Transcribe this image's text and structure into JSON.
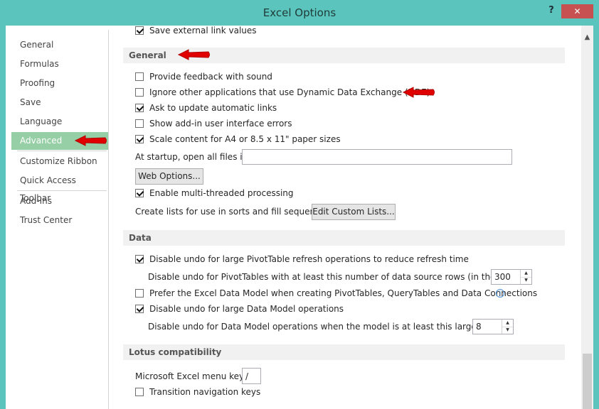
{
  "window": {
    "title": "Excel Options",
    "help_label": "?",
    "close_label": "✕"
  },
  "nav": {
    "items": [
      {
        "label": "General"
      },
      {
        "label": "Formulas"
      },
      {
        "label": "Proofing"
      },
      {
        "label": "Save"
      },
      {
        "label": "Language"
      },
      {
        "label": "Advanced",
        "active": true
      },
      {
        "label": "Customize Ribbon"
      },
      {
        "label": "Quick Access Toolbar"
      },
      {
        "label": "Add-Ins"
      },
      {
        "label": "Trust Center"
      }
    ]
  },
  "content": {
    "partial_top": {
      "label": "Save external link values",
      "checked": true
    },
    "general": {
      "header": "General",
      "feedback_sound": {
        "label": "Provide feedback with sound",
        "checked": false
      },
      "ignore_dde": {
        "label": "Ignore other applications that use Dynamic Data Exchange (DDE)",
        "checked": false
      },
      "update_links": {
        "label": "Ask to update automatic links",
        "checked": true
      },
      "addin_errors": {
        "label": "Show add-in user interface errors",
        "checked": false
      },
      "scale_content": {
        "label": "Scale content for A4 or 8.5 x 11\" paper sizes",
        "checked": true
      },
      "startup_label": "At startup, open all files in:",
      "startup_value": "",
      "web_options_label": "Web Options...",
      "multithread": {
        "label": "Enable multi-threaded processing",
        "checked": true
      },
      "custom_lists_label": "Create lists for use in sorts and fill sequences:",
      "edit_custom_lists_label": "Edit Custom Lists..."
    },
    "data": {
      "header": "Data",
      "pivot_undo": {
        "label": "Disable undo for large PivotTable refresh operations to reduce refresh time",
        "checked": true
      },
      "pivot_rows_label": "Disable undo for PivotTables with at least this number of data source rows (in thousands):",
      "pivot_rows_value": "300",
      "prefer_model": {
        "label": "Prefer the Excel Data Model when creating PivotTables, QueryTables and Data Connections",
        "checked": false
      },
      "model_undo": {
        "label": "Disable undo for large Data Model operations",
        "checked": true
      },
      "model_size_label": "Disable undo for Data Model operations when the model is at least this large (in MB):",
      "model_size_value": "8"
    },
    "lotus": {
      "header": "Lotus compatibility",
      "menu_key_label": "Microsoft Excel menu key:",
      "menu_key_value": "/",
      "transition_keys": {
        "label": "Transition navigation keys",
        "checked": false
      }
    }
  },
  "colors": {
    "accent": "#5bc5bd",
    "nav_active": "#96cfa5",
    "close": "#c75050",
    "annotation_arrow": "#e00000"
  },
  "icons": {
    "checkbox": "checkbox-icon",
    "info": "info-icon",
    "spin": "spin-arrows-icon",
    "annotation": "red-arrow-icon"
  }
}
